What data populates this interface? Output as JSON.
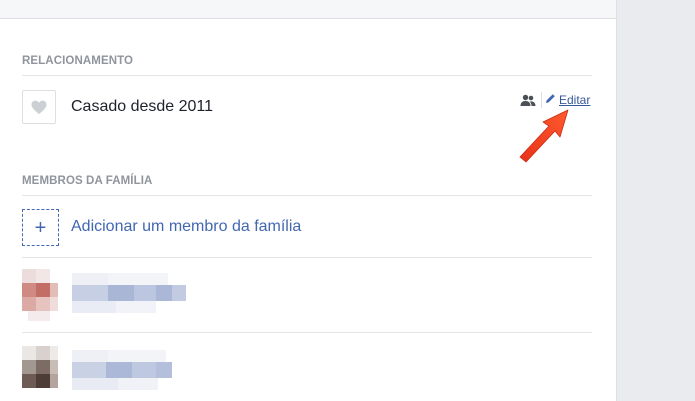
{
  "relationship": {
    "section_title": "RELACIONAMENTO",
    "status": "Casado desde 2011",
    "edit_label": "Editar",
    "heart_icon": "heart-icon",
    "audience_icon": "friends-icon",
    "edit_icon": "pencil-icon"
  },
  "family": {
    "section_title": "MEMBROS DA FAMÍLIA",
    "add_label": "Adicionar um membro da família",
    "add_icon": "plus-icon",
    "members": [
      {
        "name_redacted": true
      },
      {
        "name_redacted": true
      }
    ]
  },
  "colors": {
    "link": "#365899",
    "accent": "#4267b2",
    "header_text": "#90949c",
    "annotation_arrow": "#f03c1e"
  }
}
